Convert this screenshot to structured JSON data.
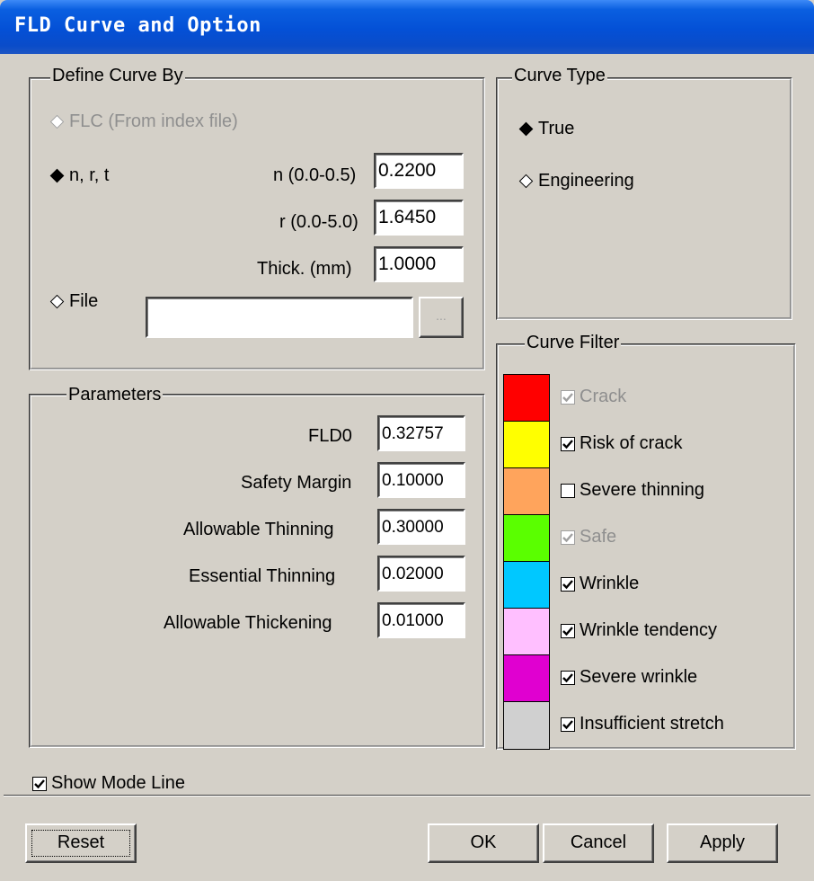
{
  "window": {
    "title": "FLD Curve and Option"
  },
  "define_curve": {
    "legend": "Define Curve By",
    "flc_label": "FLC (From index file)",
    "nrt_label": "n, r, t",
    "file_label": "File",
    "selected": "n, r, t",
    "n": {
      "label": "n (0.0-0.5)",
      "value": "0.2200"
    },
    "r": {
      "label": "r (0.0-5.0)",
      "value": "1.6450"
    },
    "thick": {
      "label": "Thick. (mm)",
      "value": "1.0000"
    },
    "file_value": "",
    "browse_label": "..."
  },
  "parameters": {
    "legend": "Parameters",
    "rows": [
      {
        "label": "FLD0",
        "value": "0.32757"
      },
      {
        "label": "Safety Margin",
        "value": "0.10000"
      },
      {
        "label": "Allowable Thinning",
        "value": "0.30000"
      },
      {
        "label": "Essential Thinning",
        "value": "0.02000"
      },
      {
        "label": "Allowable Thickening",
        "value": "0.01000"
      }
    ]
  },
  "curve_type": {
    "legend": "Curve Type",
    "true_label": "True",
    "engineering_label": "Engineering",
    "selected": "True"
  },
  "curve_filter": {
    "legend": "Curve Filter",
    "items": [
      {
        "label": "Crack",
        "color": "#ff0000",
        "checked": true,
        "enabled": false
      },
      {
        "label": "Risk of crack",
        "color": "#ffff00",
        "checked": true,
        "enabled": true
      },
      {
        "label": "Severe thinning",
        "color": "#ffa45c",
        "checked": false,
        "enabled": true
      },
      {
        "label": "Safe",
        "color": "#5aff00",
        "checked": true,
        "enabled": false
      },
      {
        "label": "Wrinkle",
        "color": "#00c8ff",
        "checked": true,
        "enabled": true
      },
      {
        "label": "Wrinkle tendency",
        "color": "#ffbfff",
        "checked": true,
        "enabled": true
      },
      {
        "label": "Severe wrinkle",
        "color": "#e000d0",
        "checked": true,
        "enabled": true
      },
      {
        "label": "Insufficient stretch",
        "color": "#d0d0d0",
        "checked": true,
        "enabled": true
      }
    ]
  },
  "show_mode_line": {
    "label": "Show Mode Line",
    "checked": true
  },
  "buttons": {
    "reset": "Reset",
    "ok": "OK",
    "cancel": "Cancel",
    "apply": "Apply"
  }
}
